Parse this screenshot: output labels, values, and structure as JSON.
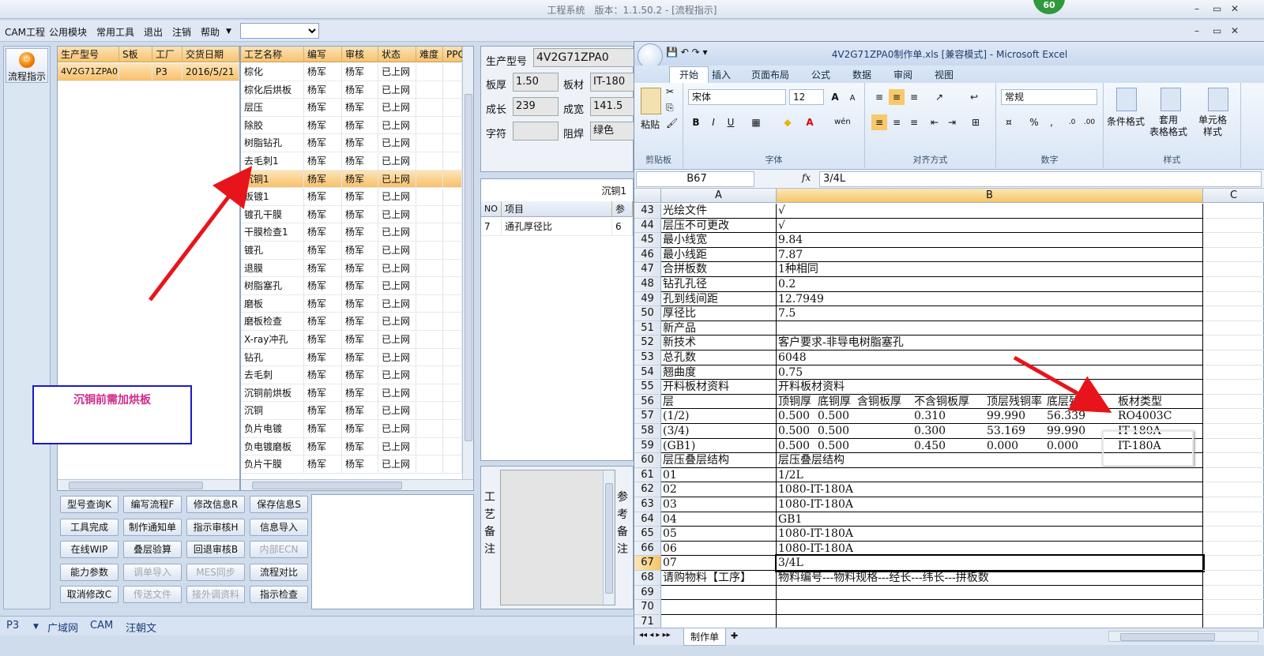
{
  "app": {
    "title": "工程系统　版本：1.1.50.2 - [流程指示]",
    "badge": "60",
    "win_controls": [
      "–",
      "▭",
      "✕"
    ],
    "mdi_controls": [
      "–",
      "▭",
      "✕"
    ]
  },
  "menu": {
    "items": [
      "CAM工程",
      "公用模块",
      "常用工具",
      "退出",
      "注销",
      "帮助"
    ],
    "dropdown_value": ""
  },
  "nav": {
    "label": "流程指示"
  },
  "orders": {
    "columns": [
      "生产型号",
      "S板",
      "工厂",
      "交货日期"
    ],
    "rows": [
      [
        "4V2G71ZPA0",
        "",
        "P3",
        "2016/5/21"
      ]
    ]
  },
  "process": {
    "columns": [
      "工艺名称",
      "编写",
      "审核",
      "状态",
      "难度",
      "PPQ"
    ],
    "rows": [
      [
        "棕化",
        "杨军",
        "杨军",
        "已上网"
      ],
      [
        "棕化后烘板",
        "杨军",
        "杨军",
        "已上网"
      ],
      [
        "层压",
        "杨军",
        "杨军",
        "已上网"
      ],
      [
        "除胶",
        "杨军",
        "杨军",
        "已上网"
      ],
      [
        "树脂钻孔",
        "杨军",
        "杨军",
        "已上网"
      ],
      [
        "去毛刺1",
        "杨军",
        "杨军",
        "已上网"
      ],
      [
        "沉铜1",
        "杨军",
        "杨军",
        "已上网"
      ],
      [
        "板镀1",
        "杨军",
        "杨军",
        "已上网"
      ],
      [
        "镀孔干膜",
        "杨军",
        "杨军",
        "已上网"
      ],
      [
        "干膜检查1",
        "杨军",
        "杨军",
        "已上网"
      ],
      [
        "镀孔",
        "杨军",
        "杨军",
        "已上网"
      ],
      [
        "退膜",
        "杨军",
        "杨军",
        "已上网"
      ],
      [
        "树脂塞孔",
        "杨军",
        "杨军",
        "已上网"
      ],
      [
        "磨板",
        "杨军",
        "杨军",
        "已上网"
      ],
      [
        "磨板检查",
        "杨军",
        "杨军",
        "已上网"
      ],
      [
        "X-ray冲孔",
        "杨军",
        "杨军",
        "已上网"
      ],
      [
        "钻孔",
        "杨军",
        "杨军",
        "已上网"
      ],
      [
        "去毛刺",
        "杨军",
        "杨军",
        "已上网"
      ],
      [
        "沉铜前烘板",
        "杨军",
        "杨军",
        "已上网"
      ],
      [
        "沉铜",
        "杨军",
        "杨军",
        "已上网"
      ],
      [
        "负片电镀",
        "杨军",
        "杨军",
        "已上网"
      ],
      [
        "负电镀磨板",
        "杨军",
        "杨军",
        "已上网"
      ],
      [
        "负片干膜",
        "杨军",
        "杨军",
        "已上网"
      ]
    ]
  },
  "note_box": {
    "text": "沉铜前需加烘板"
  },
  "buttons": [
    [
      "型号查询K",
      "编写流程F",
      "修改信息R",
      "保存信息S"
    ],
    [
      "工具完成",
      "制作通知单",
      "指示审核H",
      "信息导入"
    ],
    [
      "在线WIP",
      "叠层验算",
      "回退审核B",
      "内部ECN"
    ],
    [
      "能力参数",
      "调单导入",
      "MES同步",
      "流程对比"
    ],
    [
      "取消修改C",
      "传送文件",
      "接外调资料",
      "指示检查"
    ]
  ],
  "disabled_buttons": [
    "内部ECN",
    "调单导入",
    "MES同步",
    "传送文件",
    "接外调资料"
  ],
  "info": {
    "model_label": "生产型号",
    "model": "4V2G71ZPA0",
    "thick_label": "板厚",
    "thick": "1.50",
    "mat_label": "板材",
    "mat": "IT-180",
    "len_label": "成长",
    "len": "239",
    "wid_label": "成宽",
    "wid": "141.5",
    "char_label": "字符",
    "char": "",
    "mask_label": "阻焊",
    "mask": "绿色"
  },
  "sub": {
    "header": "沉铜1",
    "cols": [
      "NO",
      "项目",
      "参"
    ],
    "rows": [
      [
        "7",
        "通孔厚径比",
        "6"
      ]
    ]
  },
  "remark": {
    "label": "工艺备注",
    "side": "参考备注"
  },
  "status": {
    "items": [
      "P3",
      "广域网",
      "CAM",
      "汪朝文"
    ]
  },
  "excel": {
    "title": "4V2G71ZPA0制作单.xls  [兼容模式] - Microsoft Excel",
    "tabs": [
      "开始",
      "插入",
      "页面布局",
      "公式",
      "数据",
      "审阅",
      "视图"
    ],
    "font": "宋体",
    "size": "12",
    "numfmt": "常规",
    "groups": [
      "剪贴板",
      "字体",
      "对齐方式",
      "数字",
      "样式"
    ],
    "ribbon_labels": {
      "paste": "粘贴",
      "cond": "条件格式",
      "table": "套用\n表格格式",
      "cell": "单元格\n样式"
    },
    "namebox": "B67",
    "fx": "fx",
    "formula": "3/4L",
    "cols": [
      "A",
      "B",
      "C"
    ],
    "rows": [
      {
        "n": "43",
        "a": "光绘文件",
        "b": "√"
      },
      {
        "n": "44",
        "a": "层压不可更改",
        "b": "√"
      },
      {
        "n": "45",
        "a": "最小线宽",
        "b": "9.84"
      },
      {
        "n": "46",
        "a": "最小线距",
        "b": "7.87"
      },
      {
        "n": "47",
        "a": "合拼板数",
        "b": "1种相同"
      },
      {
        "n": "48",
        "a": "钻孔孔径",
        "b": "0.2"
      },
      {
        "n": "49",
        "a": "孔到线间距",
        "b": "12.7949"
      },
      {
        "n": "50",
        "a": "厚径比",
        "b": "7.5"
      },
      {
        "n": "51",
        "a": "新产品",
        "b": ""
      },
      {
        "n": "52",
        "a": "新技术",
        "b": "客户要求-非导电树脂塞孔"
      },
      {
        "n": "53",
        "a": "总孔数",
        "b": "6048"
      },
      {
        "n": "54",
        "a": "翘曲度",
        "b": "0.75"
      },
      {
        "n": "55",
        "a": "开料板材资料",
        "b": "开料板材资料"
      },
      {
        "n": "56",
        "a": "层",
        "multi": [
          "顶铜厚",
          "底铜厚",
          "含铜板厚",
          "不含铜板厚",
          "顶层残铜率",
          "底层残铜率",
          "板材类型"
        ]
      },
      {
        "n": "57",
        "a": "(1/2)",
        "multi": [
          "0.500",
          "0.500",
          "",
          "0.310",
          "99.990",
          "56.339",
          "RO4003C"
        ]
      },
      {
        "n": "58",
        "a": "(3/4)",
        "multi": [
          "0.500",
          "0.500",
          "",
          "0.300",
          "53.169",
          "99.990",
          "IT-180A"
        ]
      },
      {
        "n": "59",
        "a": "(GB1)",
        "multi": [
          "0.500",
          "0.500",
          "",
          "0.450",
          "0.000",
          "0.000",
          "IT-180A"
        ]
      },
      {
        "n": "60",
        "a": "层压叠层结构",
        "b": "层压叠层结构"
      },
      {
        "n": "61",
        "a": "01",
        "b": "1/2L"
      },
      {
        "n": "62",
        "a": "02",
        "b": "1080-IT-180A"
      },
      {
        "n": "63",
        "a": "03",
        "b": "1080-IT-180A"
      },
      {
        "n": "64",
        "a": "04",
        "b": "GB1"
      },
      {
        "n": "65",
        "a": "05",
        "b": "1080-IT-180A"
      },
      {
        "n": "66",
        "a": "06",
        "b": "1080-IT-180A"
      },
      {
        "n": "67",
        "a": "07",
        "b": "3/4L"
      },
      {
        "n": "68",
        "a": "请购物料【工序】",
        "b": "物料编号---物料规格---经长---纬长---拼板数"
      },
      {
        "n": "69",
        "a": "",
        "b": ""
      },
      {
        "n": "70",
        "a": "",
        "b": ""
      },
      {
        "n": "71",
        "a": "",
        "b": ""
      }
    ],
    "sheet_tab": "制作单"
  },
  "colors": {
    "arrow": "#e8141b",
    "selected_row": "#f8c06a",
    "note_border": "#1a1ac8",
    "note_text": "#d02a8a"
  }
}
